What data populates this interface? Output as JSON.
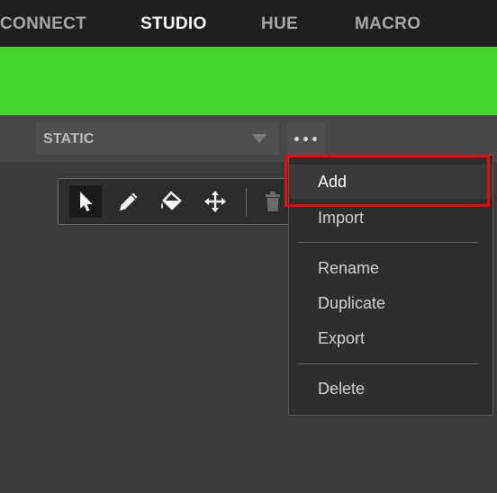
{
  "nav": {
    "tabs": [
      {
        "label": "CONNECT"
      },
      {
        "label": "STUDIO"
      },
      {
        "label": "HUE"
      },
      {
        "label": "MACRO"
      }
    ],
    "active_tab": "STUDIO"
  },
  "banner": {
    "color": "#44d62c"
  },
  "effect_select": {
    "value": "STATIC"
  },
  "more_button": {
    "icon": "more-horizontal-icon"
  },
  "tools": [
    {
      "icon": "pointer-icon",
      "active": true
    },
    {
      "icon": "pencil-icon",
      "active": false
    },
    {
      "icon": "paint-bucket-icon",
      "active": false
    },
    {
      "icon": "move-icon",
      "active": false
    },
    {
      "icon": "trash-icon",
      "active": false
    }
  ],
  "menu": {
    "items": [
      {
        "label": "Add"
      },
      {
        "label": "Import"
      },
      {
        "label": "Rename"
      },
      {
        "label": "Duplicate"
      },
      {
        "label": "Export"
      },
      {
        "label": "Delete"
      }
    ],
    "highlighted": "Add",
    "highlight_color": "#ff0000"
  }
}
